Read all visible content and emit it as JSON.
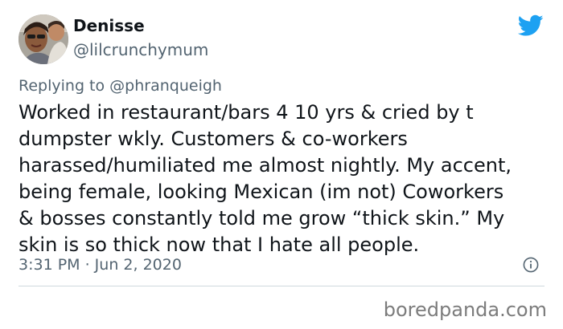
{
  "tweet": {
    "author_name": "Denisse",
    "author_handle": "@lilcrunchymum",
    "replying_to_prefix": "Replying to",
    "replying_to_handle": "@phranqueigh",
    "text": "Worked in restaurant/bars 4 10 yrs & cried by t\ndumpster wkly. Customers & co-workers\nharassed/humiliated me almost nightly. My accent,\nbeing female, looking Mexican (im not) Coworkers\n& bosses constantly told me grow “thick skin.” My\nskin is so thick now that I hate all people.",
    "timestamp": "3:31 PM · Jun 2, 2020"
  },
  "icons": {
    "platform": "twitter-bird-icon",
    "info": "info-icon"
  },
  "colors": {
    "brand_blue": "#1da1f2",
    "text": "#0f1419",
    "muted": "#536471"
  },
  "watermark": "boredpanda.com"
}
